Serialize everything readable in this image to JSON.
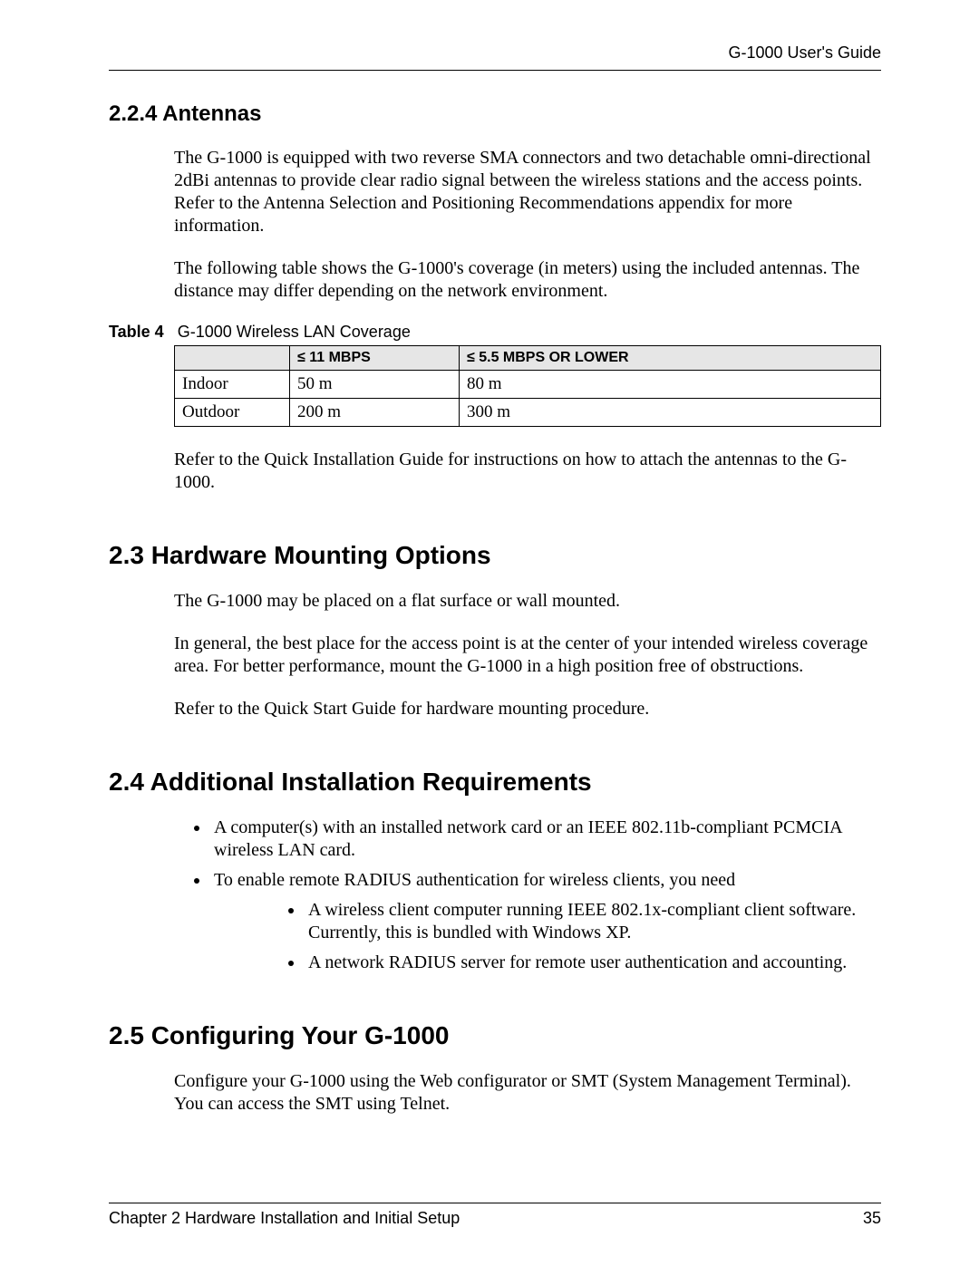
{
  "header": {
    "running": "G-1000 User's Guide"
  },
  "section_224": {
    "heading": "2.2.4  Antennas",
    "p1": "The G-1000 is equipped with two reverse SMA connectors and two detachable omni-directional 2dBi antennas to provide clear radio signal between the wireless stations and the access points. Refer to the Antenna Selection and Positioning Recommendations appendix for more information.",
    "p2": "The following table shows the G-1000's coverage (in meters) using the included antennas. The distance may differ depending on the network environment.",
    "p3": "Refer to the Quick Installation Guide for instructions on how to attach the antennas to the G-1000."
  },
  "table4": {
    "caption_label": "Table 4",
    "caption_text": "G-1000 Wireless LAN Coverage",
    "head": {
      "c1": "",
      "c2": "≤ 11 MBPS",
      "c3": "≤ 5.5 MBPS OR LOWER"
    },
    "rows": [
      {
        "c1": "Indoor",
        "c2": "50 m",
        "c3": "80 m"
      },
      {
        "c1": "Outdoor",
        "c2": "200 m",
        "c3": "300 m"
      }
    ]
  },
  "section_23": {
    "heading": "2.3  Hardware Mounting Options",
    "p1": "The G-1000 may be placed on a flat surface or wall mounted.",
    "p2": "In general, the best place for the access point is at the center of your intended wireless coverage area. For better performance, mount the G-1000 in a high position free of obstructions.",
    "p3": "Refer to the Quick Start Guide for hardware mounting procedure."
  },
  "section_24": {
    "heading": "2.4  Additional Installation Requirements",
    "bullets": [
      "A computer(s) with an installed network card or an IEEE 802.11b-compliant PCMCIA wireless LAN card.",
      "To enable remote RADIUS authentication for wireless clients, you need"
    ],
    "sub_bullets": [
      "A wireless client computer running IEEE 802.1x-compliant client software. Currently, this is bundled with Windows XP.",
      "A network RADIUS server for remote user authentication and accounting."
    ]
  },
  "section_25": {
    "heading": "2.5  Configuring Your G-1000",
    "p1": "Configure your G-1000 using the Web configurator or SMT (System Management Terminal). You can access the SMT using Telnet."
  },
  "footer": {
    "left": "Chapter 2 Hardware Installation and Initial Setup",
    "right": "35"
  }
}
